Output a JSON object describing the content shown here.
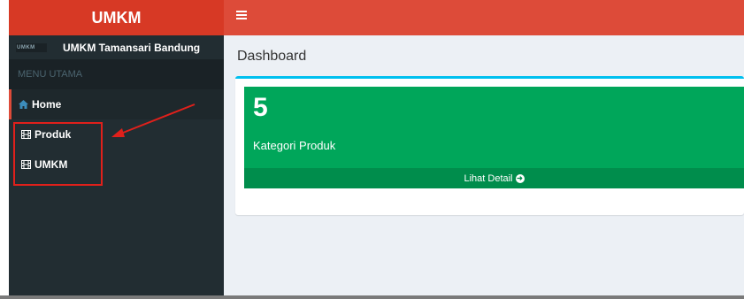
{
  "sidebar": {
    "logo": "UMKM",
    "user_logo_text": "UMKM",
    "user_name": "UMKM Tamansari Bandung",
    "menu_header": "MENU UTAMA",
    "items": [
      {
        "label": "Home",
        "icon": "home-icon"
      },
      {
        "label": "Produk",
        "icon": "film-icon"
      },
      {
        "label": "UMKM",
        "icon": "film-icon"
      }
    ]
  },
  "header": {
    "toggle_icon": "hamburger-icon"
  },
  "main": {
    "title": "Dashboard",
    "stat": {
      "value": "5",
      "label": "Kategori Produk",
      "link": "Lihat Detail"
    }
  },
  "colors": {
    "logo_bg": "#d73925",
    "navbar_bg": "#dd4b39",
    "sidebar_bg": "#222d32",
    "box_green": "#00a65a",
    "box_footer": "#008d4c",
    "accent_top": "#00c0ef",
    "annotation": "#e0201b"
  }
}
